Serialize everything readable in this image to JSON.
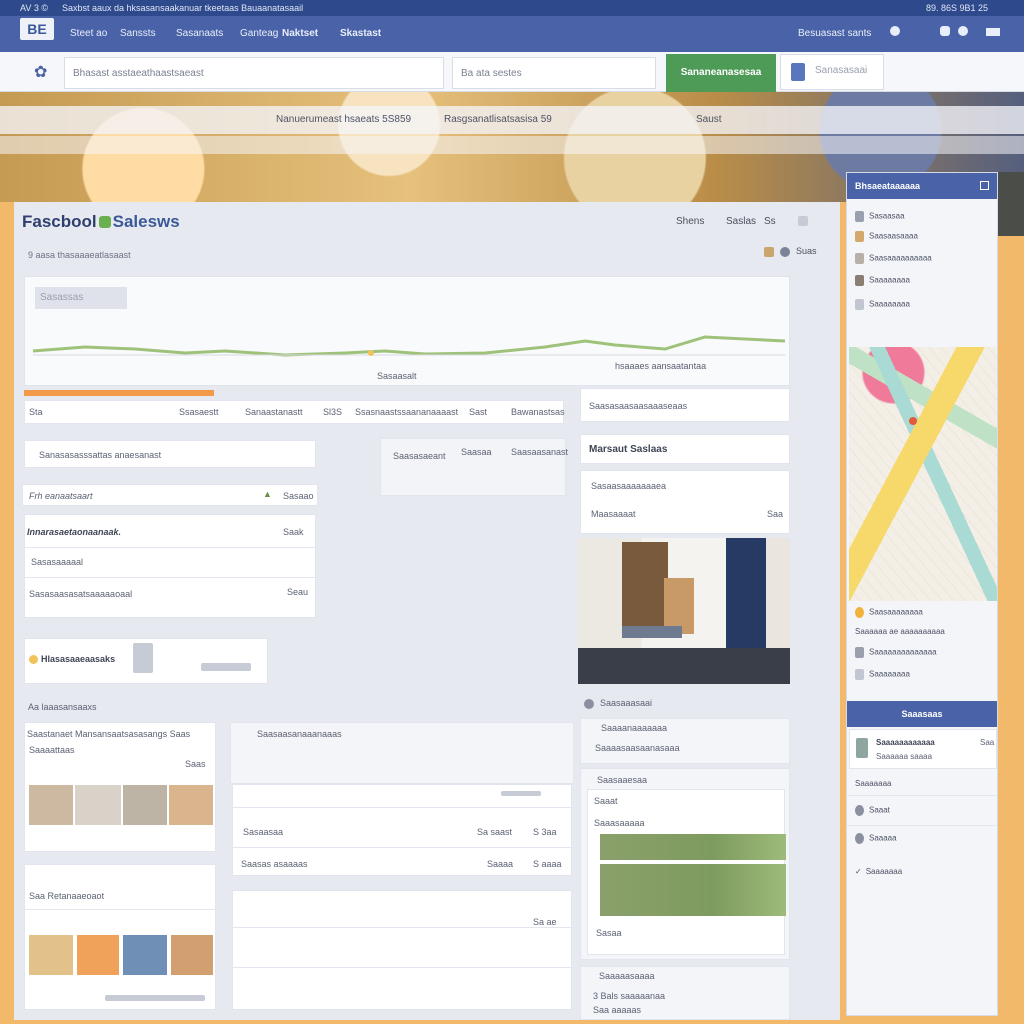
{
  "os_bar": {
    "left": "AV 3 ©",
    "title": "Saxbst aaux da hksasansaakanuar tkeetaas Bauaanatasaail",
    "right": "89.  86S  9B1  25"
  },
  "navbar": {
    "logo": "BE",
    "items": [
      "Steet ao",
      "Sanssts",
      "Sasanaats",
      "Ganteag",
      "Naktset",
      "Skastast"
    ],
    "right_label": "Besuasast sants"
  },
  "search": {
    "placeholder_main": "Bhasast asstaeathaastsaeast",
    "placeholder_secondary": "Ba ata sestes",
    "post_button": "Sananeanasesaa",
    "account_label": "Sanasasaai"
  },
  "hero": {
    "tab_1": "Nanuerumeast hsaeats 5S859",
    "tab_2": "Rasgsanatlisatsasisa 59",
    "tab_3": "Saust"
  },
  "main": {
    "brand_prefix": "Fascbool",
    "brand_suffix": "Salesws",
    "header_tabs": [
      "Shens",
      "Saslas",
      "Ss"
    ],
    "breadcrumb": "9 aasa thasaaaeatlasaast",
    "header_icon_label": "Suas",
    "chart_heading": "Sasassas",
    "chart_caption_left": "Sasaasalt",
    "chart_caption_right": "hsaaaes aansaatantaa",
    "stats_row": [
      "Sta",
      "Ssasaestt",
      "Sanaastanastt",
      "Sl3S",
      "Ssasnaastssaananaaaast",
      "Sast",
      "Bawanastsas"
    ],
    "info_row": "Sanasasasssattas anaesanast",
    "info_right": [
      "Saasasaeant",
      "Saasaa",
      "Saasaasanast"
    ],
    "list_header": "Frh eanaatsaart",
    "list_header_right": "Sasaao",
    "card_title": "Innarasaetaonaanaak.",
    "card_title_right": "Saak",
    "card_row_1": "Sasasaaaaal",
    "card_row_2": "Sasasaasasatsaaaaaoaal",
    "card_row_2_right": "Seau",
    "highlight_label": "Hlasasaaeaasaks",
    "section_label": "Aa laaasansaaxs",
    "mini_card_1_title": "Saastanaet Mansansaatsasasangs  Saas",
    "mini_card_1_sub": "Saaaattaas",
    "mini_card_1_badge": "Saas",
    "mini_card_2_title": "Saa Retanaaeoaot",
    "table_title": "Saasaasanaaanaaas",
    "table_rows": [
      {
        "a": "Sasaasaa",
        "b": "Sa saast",
        "c": "S 3aa"
      },
      {
        "a": "Saasas asaaaas",
        "b": "Saaaa",
        "c": "S aaaa"
      }
    ],
    "table_footer": "Sa ae",
    "col3_row_1": "Saasasaasaasaaaseaas",
    "col3_title": "Marsaut  Saslaas",
    "col3_card_line_1": "Sasaasaaaaaaaea",
    "col3_card_line_2": "Maasaaaat",
    "col3_card_right": "Saa",
    "col3_footer_1": "Saasaaasaai",
    "col3_footer_2": "Saaaanaaaaaaa",
    "col3_footer_3": "Saaaasaasaanasaaa",
    "col3_panel_title": "Saasaaesaa",
    "col3_panel_line_1": "Saaat",
    "col3_panel_line_2": "Saaasaaaaa",
    "col3_panel_footer": "Sasaa",
    "col3_bottom_1": "Saaaaasaaaa",
    "col3_bottom_2": "3 Bals saaaaanaa",
    "col3_bottom_3": "Saa aaaaas"
  },
  "sidebar": {
    "head_1": "Bhsaeataaaaaa",
    "items_1": [
      "Sasaasaa",
      "Saasaasaaaa",
      "Saasaaaaaaaaaa",
      "Saaaaaaaa",
      "Saaaaaaaa"
    ],
    "items_2": [
      "Saasaaaaaaaa",
      "Saaaaaa ae aaaaaaaaaa",
      "Saaaaaaaaaaaaaa",
      "Saaaaaaaa"
    ],
    "head_2": "Saaasaas",
    "feature_title": "Saaaaaaaaaaaa",
    "feature_sub": "Saaaaaa saaaa",
    "feature_right": "Saa",
    "footer_title": "Saaaaaaa",
    "footer_items": [
      "Saaat",
      "Saaaaa",
      "Saaaaaaa"
    ]
  },
  "colors": {
    "navbar": "#4a63a8",
    "accent_green": "#4e9a57",
    "accent_orange": "#f29a4a",
    "background": "#f2b96a"
  }
}
